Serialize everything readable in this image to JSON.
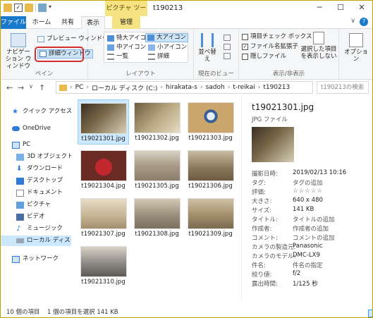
{
  "window": {
    "title": "t190213",
    "contextual_tab_group": "ピクチャ ツール",
    "controls": [
      "─",
      "☐",
      "✕"
    ]
  },
  "tabs": [
    {
      "label": "ファイル"
    },
    {
      "label": "ホーム"
    },
    {
      "label": "共有"
    },
    {
      "label": "表示"
    },
    {
      "label": "管理"
    }
  ],
  "ribbon": {
    "pane": {
      "nav_pane_label": "ナビゲーション ウィンドウ",
      "preview_label": "プレビュー ウィンドウ",
      "details_label": "詳細ウィンドウ",
      "group_label": "ペイン"
    },
    "layout": {
      "items": [
        "特大アイコン",
        "大アイコン",
        "中アイコン",
        "小アイコン",
        "一覧",
        "詳細"
      ],
      "group_label": "レイアウト"
    },
    "current_view": {
      "sort_label": "並べ替え",
      "group_label": "現在のビュー"
    },
    "show_hide": {
      "item_checkbox_label": "項目チェック ボックス",
      "extension_label": "ファイル名拡張子",
      "hidden_label": "隠しファイル",
      "hide_selected_label": "選択した項目を表示しない",
      "group_label": "表示/非表示",
      "item_checkbox_checked": false,
      "extension_checked": true,
      "hidden_checked": false
    },
    "options_label": "オプション"
  },
  "address": {
    "breadcrumbs": [
      "PC",
      "ローカル ディスク (C:)",
      "hirakata-s",
      "sadoh",
      "t-reikai",
      "t190213"
    ],
    "search_placeholder": "t190213の検索"
  },
  "nav": [
    {
      "label": "クイック アクセス",
      "icon": "star-icon"
    },
    {
      "label": "OneDrive",
      "icon": "cloud-icon"
    },
    {
      "label": "PC",
      "icon": "computer-icon"
    },
    {
      "label": "3D オブジェクト",
      "icon": "cube-icon"
    },
    {
      "label": "ダウンロード",
      "icon": "download-icon"
    },
    {
      "label": "デスクトップ",
      "icon": "desktop-icon"
    },
    {
      "label": "ドキュメント",
      "icon": "document-icon"
    },
    {
      "label": "ピクチャ",
      "icon": "picture-icon"
    },
    {
      "label": "ビデオ",
      "icon": "video-icon"
    },
    {
      "label": "ミュージック",
      "icon": "music-icon"
    },
    {
      "label": "ローカル ディスク (C:)",
      "icon": "disk-icon"
    },
    {
      "label": "ネットワーク",
      "icon": "network-icon"
    }
  ],
  "files": [
    {
      "name": "t19021301.jpg"
    },
    {
      "name": "t19021302.jpg"
    },
    {
      "name": "t19021303.jpg"
    },
    {
      "name": "t19021304.jpg"
    },
    {
      "name": "t19021305.jpg"
    },
    {
      "name": "t19021306.jpg"
    },
    {
      "name": "t19021307.jpg"
    },
    {
      "name": "t19021308.jpg"
    },
    {
      "name": "t19021309.jpg"
    },
    {
      "name": "t19021310.jpg"
    }
  ],
  "details": {
    "title": "t19021301.jpg",
    "type": "JPG ファイル",
    "props": [
      {
        "k": "撮影日時:",
        "v": "2019/02/13 10:16"
      },
      {
        "k": "タグ:",
        "v": "タグの追加"
      },
      {
        "k": "評価:",
        "v": "☆☆☆☆☆"
      },
      {
        "k": "大きさ:",
        "v": "640 x 480"
      },
      {
        "k": "サイズ:",
        "v": "141 KB"
      },
      {
        "k": "タイトル:",
        "v": "タイトルの追加"
      },
      {
        "k": "作成者:",
        "v": "作成者の追加"
      },
      {
        "k": "コメント:",
        "v": "コメントの追加"
      },
      {
        "k": "カメラの製造元:",
        "v": "Panasonic"
      },
      {
        "k": "カメラのモデル:",
        "v": "DMC-LX9"
      },
      {
        "k": "件名:",
        "v": "件名の指定"
      },
      {
        "k": "絞り値:",
        "v": "f/2"
      },
      {
        "k": "露出時間:",
        "v": "1/125 秒"
      }
    ]
  },
  "status": {
    "count": "10 個の項目",
    "selection": "1 個の項目を選択  141 KB"
  }
}
